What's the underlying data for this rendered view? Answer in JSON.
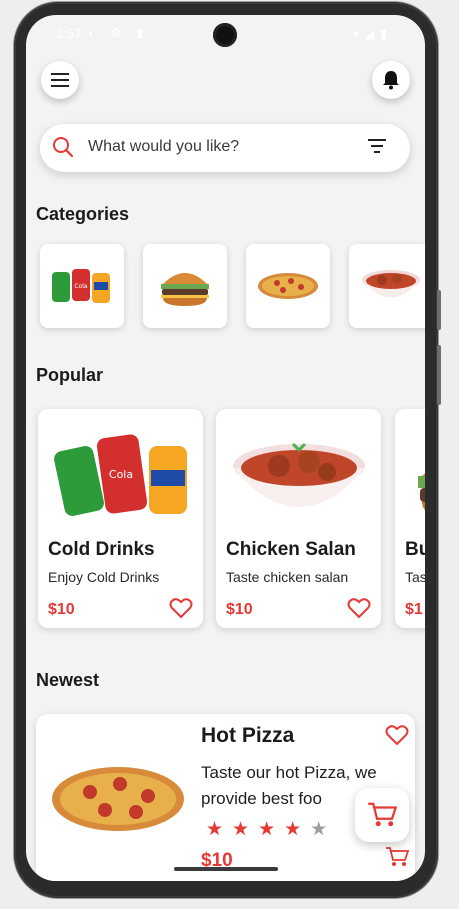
{
  "status_bar": {
    "time": "3:57",
    "left_icons": "◐ ⚙ ▮",
    "right_icons": "▾◢▮"
  },
  "search": {
    "placeholder": "What would you like?"
  },
  "sections": {
    "categories": "Categories",
    "popular": "Popular",
    "newest": "Newest"
  },
  "categories": [
    {
      "name": "drinks",
      "icon": "soda-cans-icon"
    },
    {
      "name": "burger",
      "icon": "burger-icon"
    },
    {
      "name": "pizza",
      "icon": "pizza-icon"
    },
    {
      "name": "curry",
      "icon": "curry-bowl-icon"
    }
  ],
  "popular": [
    {
      "name": "Cold Drinks",
      "desc": "Enjoy Cold Drinks",
      "price": "$10"
    },
    {
      "name": "Chicken Salan",
      "desc": "Taste chicken salan",
      "price": "$10"
    },
    {
      "name": "Bu",
      "desc": "Tas",
      "price": "$1"
    }
  ],
  "newest": [
    {
      "name": "Hot Pizza",
      "desc": "Taste our hot Pizza, we provide best foo",
      "price": "$10",
      "rating": 4,
      "rating_max": 5
    }
  ],
  "colors": {
    "accent": "#e53935",
    "background": "#f4f3f2",
    "card": "#ffffff"
  }
}
